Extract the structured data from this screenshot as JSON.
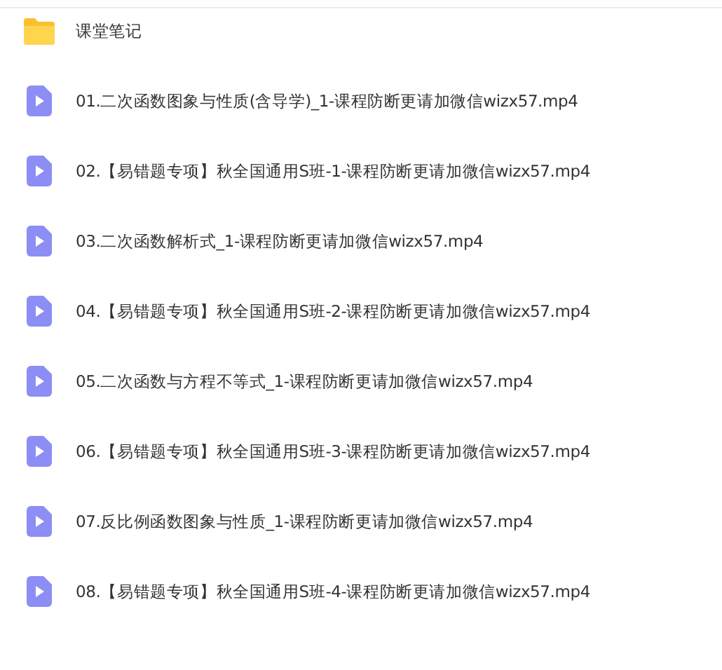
{
  "files": [
    {
      "kind": "folder",
      "name": "课堂笔记"
    },
    {
      "kind": "video",
      "name": "01.二次函数图象与性质(含导学)_1-课程防断更请加微信wizx57.mp4"
    },
    {
      "kind": "video",
      "name": "02.【易错题专项】秋全国通用S班-1-课程防断更请加微信wizx57.mp4"
    },
    {
      "kind": "video",
      "name": "03.二次函数解析式_1-课程防断更请加微信wizx57.mp4"
    },
    {
      "kind": "video",
      "name": "04.【易错题专项】秋全国通用S班-2-课程防断更请加微信wizx57.mp4"
    },
    {
      "kind": "video",
      "name": "05.二次函数与方程不等式_1-课程防断更请加微信wizx57.mp4"
    },
    {
      "kind": "video",
      "name": "06.【易错题专项】秋全国通用S班-3-课程防断更请加微信wizx57.mp4"
    },
    {
      "kind": "video",
      "name": "07.反比例函数图象与性质_1-课程防断更请加微信wizx57.mp4"
    },
    {
      "kind": "video",
      "name": "08.【易错题专项】秋全国通用S班-4-课程防断更请加微信wizx57.mp4"
    }
  ]
}
